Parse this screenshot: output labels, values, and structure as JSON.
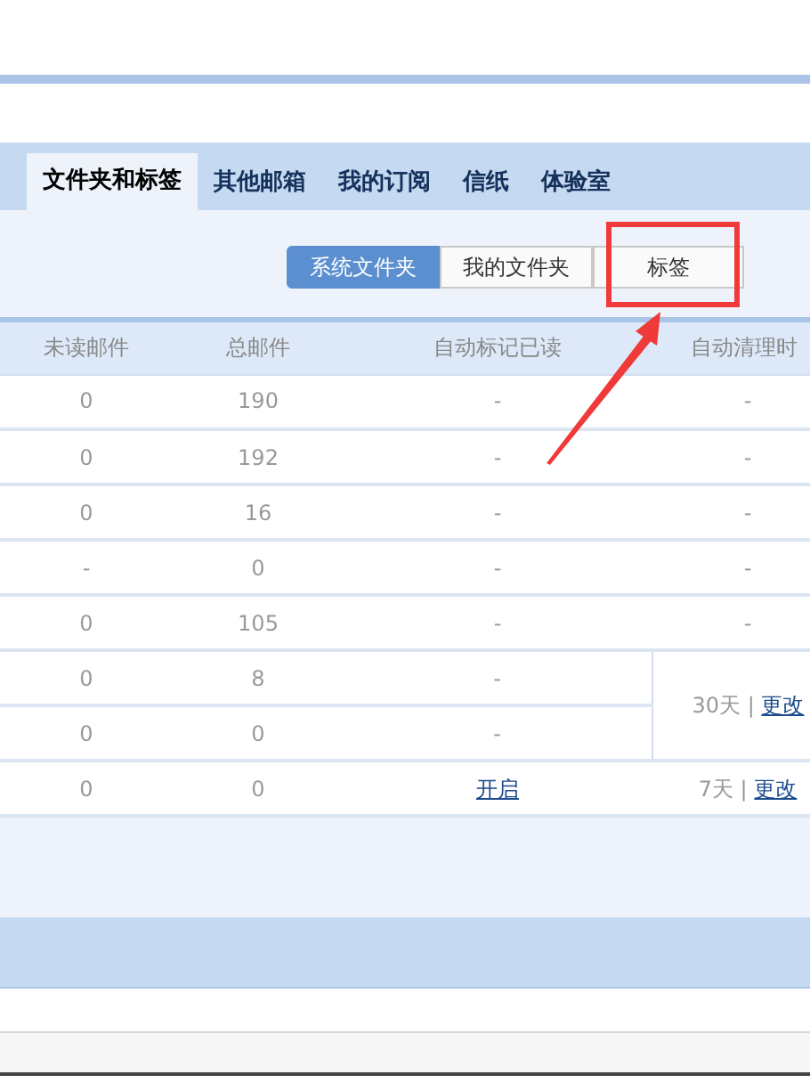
{
  "tabs": [
    {
      "label": "文件夹和标签",
      "selected": true
    },
    {
      "label": "其他邮箱",
      "selected": false
    },
    {
      "label": "我的订阅",
      "selected": false
    },
    {
      "label": "信纸",
      "selected": false
    },
    {
      "label": "体验室",
      "selected": false
    }
  ],
  "folder_switch": [
    {
      "label": "系统文件夹",
      "selected": true
    },
    {
      "label": "我的文件夹",
      "selected": false
    },
    {
      "label": "标签",
      "selected": false
    }
  ],
  "table": {
    "columns": [
      "未读邮件",
      "总邮件",
      "自动标记已读",
      "自动清理时"
    ],
    "rows": [
      {
        "unread": "0",
        "total": "190",
        "auto_read": {
          "text": "-",
          "kind": "text"
        },
        "auto_clean": {
          "days": "-"
        }
      },
      {
        "unread": "0",
        "total": "192",
        "auto_read": {
          "text": "-",
          "kind": "text"
        },
        "auto_clean": {
          "days": "-"
        }
      },
      {
        "unread": "0",
        "total": "16",
        "auto_read": {
          "text": "-",
          "kind": "text"
        },
        "auto_clean": {
          "days": "-"
        }
      },
      {
        "unread": "-",
        "total": "0",
        "auto_read": {
          "text": "-",
          "kind": "text"
        },
        "auto_clean": {
          "days": "-"
        }
      },
      {
        "unread": "0",
        "total": "105",
        "auto_read": {
          "text": "-",
          "kind": "text"
        },
        "auto_clean": {
          "days": "-"
        }
      },
      {
        "unread": "0",
        "total": "8",
        "auto_read": {
          "text": "-",
          "kind": "text"
        },
        "auto_clean": {
          "days": "30天",
          "separator": "|",
          "link": "更改",
          "spans_next_row": true
        }
      },
      {
        "unread": "0",
        "total": "0",
        "auto_read": {
          "text": "-",
          "kind": "text"
        }
      },
      {
        "unread": "0",
        "total": "0",
        "auto_read": {
          "text": "开启",
          "kind": "link"
        },
        "auto_clean": {
          "days": "7天",
          "separator": "|",
          "link": "更改"
        }
      }
    ]
  }
}
